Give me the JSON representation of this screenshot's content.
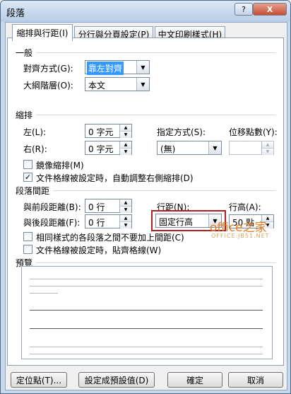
{
  "window": {
    "title": "段落",
    "help_button": "?",
    "close_button": "X"
  },
  "tabs": [
    {
      "label": "縮排與行距(I)",
      "active": true
    },
    {
      "label": "分行與分頁設定(P)",
      "active": false
    },
    {
      "label": "中文印刷樣式(H)",
      "active": false
    }
  ],
  "general": {
    "heading": "一般",
    "alignment_label": "對齊方式(G):",
    "alignment_value": "靠左對齊",
    "outline_label": "大綱階層(O):",
    "outline_value": "本文"
  },
  "indent": {
    "heading": "縮排",
    "left_label": "左(L):",
    "left_value": "0 字元",
    "right_label": "右(R):",
    "right_value": "0 字元",
    "special_label": "指定方式(S):",
    "special_value": "(無)",
    "offset_label": "位移點數(Y):",
    "offset_value": "",
    "mirror_label": "鏡像縮排(M)",
    "mirror_checked": false,
    "auto_adjust_label": "文件格線被設定時，自動調整右側縮排(D)",
    "auto_adjust_checked": true
  },
  "spacing": {
    "heading": "段落間距",
    "before_label": "與前段距離(B):",
    "before_value": "0 行",
    "after_label": "與後段距離(F):",
    "after_value": "0 行",
    "line_spacing_label": "行距(N):",
    "line_spacing_value": "固定行高",
    "at_label": "行高(A):",
    "at_value": "50 點",
    "no_space_same_style_label": "相同樣式的各段落之間不要加上間距(C)",
    "no_space_same_style_checked": false,
    "snap_grid_label": "文件格線被設定時，貼齊格線(W)",
    "snap_grid_checked": false
  },
  "preview": {
    "heading": "預覽"
  },
  "buttons": {
    "tabs": "定位點(T)...",
    "default": "設定成預設值(D)",
    "ok": "確定",
    "cancel": "取消"
  },
  "watermark": {
    "brand": "office之家",
    "url": "OFFICE.JB51.NET"
  },
  "colors": {
    "accent": "#3399ff",
    "highlight_box": "#b02020",
    "watermark": "#e67e22"
  }
}
